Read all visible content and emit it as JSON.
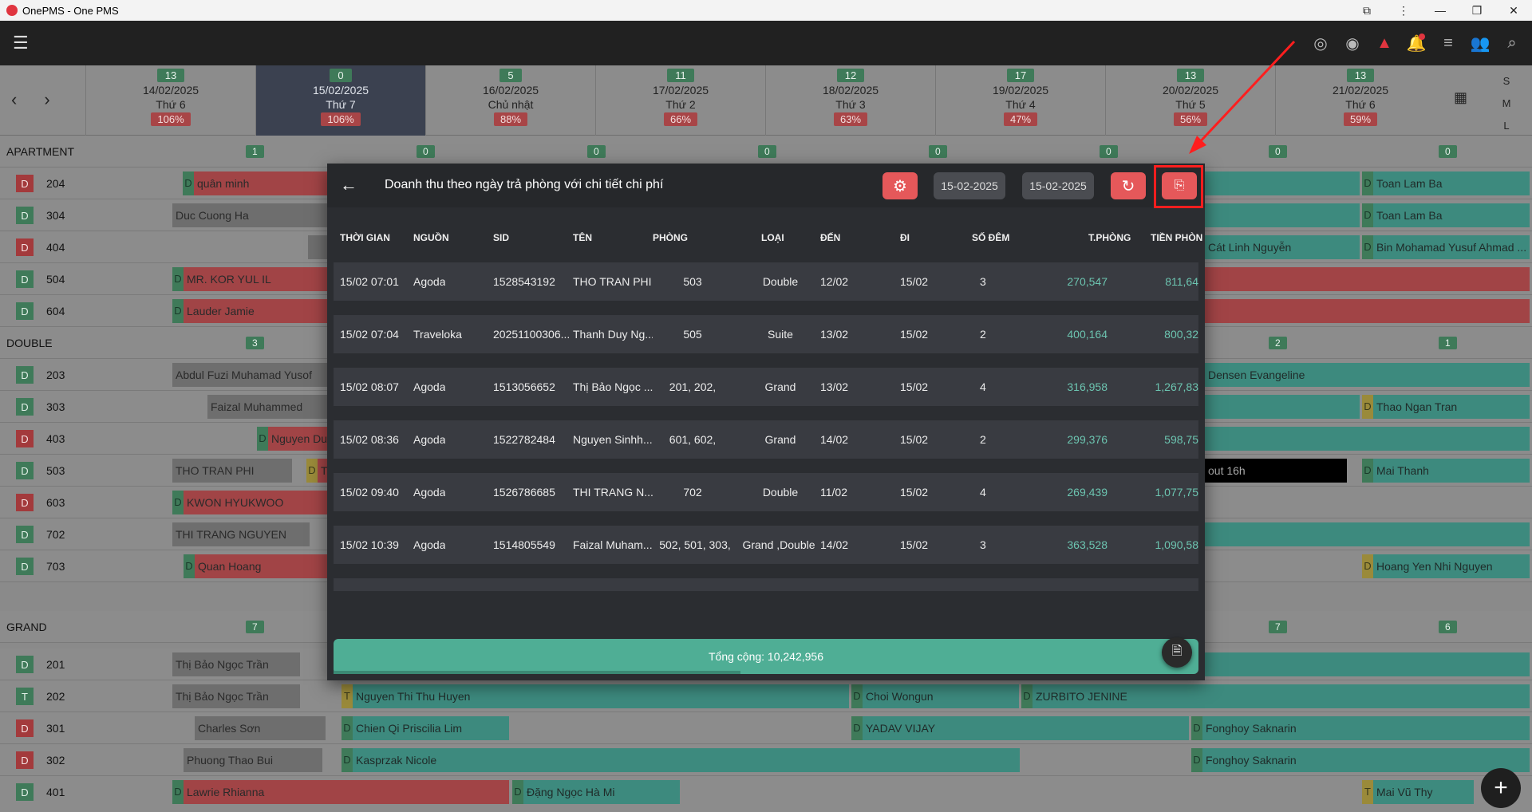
{
  "titlebar": {
    "title": "OnePMS - One PMS",
    "buttons": [
      "⧉",
      "⋮",
      "—",
      "❐",
      "✕"
    ]
  },
  "appbar": {
    "menu_icon": "☰",
    "icons": [
      {
        "name": "fingerprint-icon",
        "glyph": "◎"
      },
      {
        "name": "eye-icon",
        "glyph": "◉"
      },
      {
        "name": "warning-icon",
        "glyph": "▲"
      },
      {
        "name": "bell-icon",
        "glyph": "🔔"
      },
      {
        "name": "list-icon",
        "glyph": "≡"
      },
      {
        "name": "add-user-icon",
        "glyph": "👥"
      },
      {
        "name": "search-icon",
        "glyph": "⌕"
      }
    ]
  },
  "nav": {
    "prev": "‹",
    "next": "›"
  },
  "days": [
    {
      "count": "13",
      "date": "14/02/2025",
      "weekday": "Thứ 6",
      "pct": "106%"
    },
    {
      "count": "0",
      "date": "15/02/2025",
      "weekday": "Thứ 7",
      "pct": "106%"
    },
    {
      "count": "5",
      "date": "16/02/2025",
      "weekday": "Chủ nhật",
      "pct": "88%"
    },
    {
      "count": "11",
      "date": "17/02/2025",
      "weekday": "Thứ 2",
      "pct": "66%"
    },
    {
      "count": "12",
      "date": "18/02/2025",
      "weekday": "Thứ 3",
      "pct": "63%"
    },
    {
      "count": "17",
      "date": "19/02/2025",
      "weekday": "Thứ 4",
      "pct": "47%"
    },
    {
      "count": "13",
      "date": "20/02/2025",
      "weekday": "Thứ 5",
      "pct": "56%"
    },
    {
      "count": "13",
      "date": "21/02/2025",
      "weekday": "Thứ 6",
      "pct": "59%"
    }
  ],
  "sizes": [
    "S",
    "M",
    "L"
  ],
  "groups": {
    "apartment": {
      "name": "APARTMENT",
      "counts": [
        "1",
        "0",
        "0",
        "0",
        "0",
        "0",
        "0",
        "0"
      ]
    },
    "double": {
      "name": "DOUBLE",
      "counts": [
        "3",
        "2",
        "1"
      ]
    },
    "grand": {
      "name": "GRAND",
      "counts": [
        "7",
        "7",
        "6"
      ]
    }
  },
  "rooms": [
    {
      "type": "D",
      "num": "204"
    },
    {
      "type": "D",
      "num": "304"
    },
    {
      "type": "D",
      "num": "404"
    },
    {
      "type": "D",
      "num": "504"
    },
    {
      "type": "D",
      "num": "604"
    },
    {
      "type": "D",
      "num": "203"
    },
    {
      "type": "D",
      "num": "303"
    },
    {
      "type": "D",
      "num": "403"
    },
    {
      "type": "D",
      "num": "503"
    },
    {
      "type": "D",
      "num": "603"
    },
    {
      "type": "D",
      "num": "702"
    },
    {
      "type": "D",
      "num": "703"
    },
    {
      "type": "D",
      "num": "201"
    },
    {
      "type": "T",
      "num": "202"
    },
    {
      "type": "D",
      "num": "301"
    },
    {
      "type": "D",
      "num": "302"
    },
    {
      "type": "D",
      "num": "401"
    }
  ],
  "bookings": {
    "b204a": "quân minh",
    "b204b": "Toan Lam Ba",
    "b304a": "Duc Cuong Ha",
    "b304b": "Toan Lam Ba",
    "b404a": "Cát Linh Nguyễn",
    "b404b": "Bin Mohamad Yusuf Ahmad ...",
    "b504a": "MR. KOR YUL IL",
    "b604a": "Lauder Jamie",
    "b203a": "Abdul Fuzi Muhamad Yusof",
    "b203b": "Densen Evangeline",
    "b303a": "Faizal Muhammed",
    "b303b": "Thao Ngan Tran",
    "b403a": "Nguyen Du",
    "b503a": "THO TRAN PHI",
    "b503b": "T",
    "b503c": "out 16h",
    "b503d": "Mai Thanh",
    "b603a": "KWON HYUKWOO",
    "b702a": "THI TRANG NGUYEN",
    "b703a": "Quan Hoang",
    "b703b": "Hoang Yen Nhi Nguyen",
    "b201a": "Thị Bảo Ngọc Trần",
    "b202a": "Thị Bảo Ngọc Trần",
    "b202b": "Nguyen Thi Thu Huyen",
    "b202c": "Choi Wongun",
    "b202d": "ZURBITO JENINE",
    "b301a": "Charles Sơn",
    "b301b": "Chien Qi Priscilia Lim",
    "b301c": "YADAV VIJAY",
    "b301d": "Fonghoy Saknarin",
    "b302a": "Phuong Thao Bui",
    "b302b": "Kasprzak Nicole",
    "b302c": "Fonghoy Saknarin",
    "b401a": "Lawrie Rhianna",
    "b401b": "Đặng Ngọc Hà Mi",
    "b401c": "Mai Vũ Thy"
  },
  "tags": {
    "D": "D",
    "T": "T"
  },
  "modal": {
    "back": "←",
    "title": "Doanh thu theo ngày trả phòng với chi tiết chi phí",
    "gear": "⚙",
    "date_from": "15-02-2025",
    "date_to": "15-02-2025",
    "refresh": "↻",
    "export": "⎘",
    "columns": [
      "THỜI GIAN",
      "NGUỒN",
      "SID",
      "TÊN",
      "PHÒNG",
      "LOẠI",
      "ĐẾN",
      "ĐI",
      "SỐ ĐÊM",
      "T.PHÒNG",
      "TIỀN PHÒN"
    ],
    "rows": [
      [
        "15/02 07:01",
        "Agoda",
        "1528543192",
        "THO TRAN PHI",
        "503",
        "Double",
        "12/02",
        "15/02",
        "3",
        "270,547",
        "811,64"
      ],
      [
        "15/02 07:04",
        "Traveloka",
        "20251100306...",
        "Thanh Duy Ng...",
        "505",
        "Suite",
        "13/02",
        "15/02",
        "2",
        "400,164",
        "800,32"
      ],
      [
        "15/02 08:07",
        "Agoda",
        "1513056652",
        "Thị Bảo Ngọc ...",
        "201, 202,",
        "Grand",
        "13/02",
        "15/02",
        "4",
        "316,958",
        "1,267,83"
      ],
      [
        "15/02 08:36",
        "Agoda",
        "1522782484",
        "Nguyen Sinhh...",
        "601, 602,",
        "Grand",
        "14/02",
        "15/02",
        "2",
        "299,376",
        "598,75"
      ],
      [
        "15/02 09:40",
        "Agoda",
        "1526786685",
        "THI TRANG N...",
        "702",
        "Double",
        "11/02",
        "15/02",
        "4",
        "269,439",
        "1,077,75"
      ],
      [
        "15/02 10:39",
        "Agoda",
        "1514805549",
        "Faizal Muham...",
        "502, 501, 303,",
        "Grand ,Double",
        "14/02",
        "15/02",
        "3",
        "363,528",
        "1,090,58"
      ]
    ],
    "total": "Tổng cộng: 10,242,956",
    "doc_icon": "🗎"
  },
  "fab": "+"
}
